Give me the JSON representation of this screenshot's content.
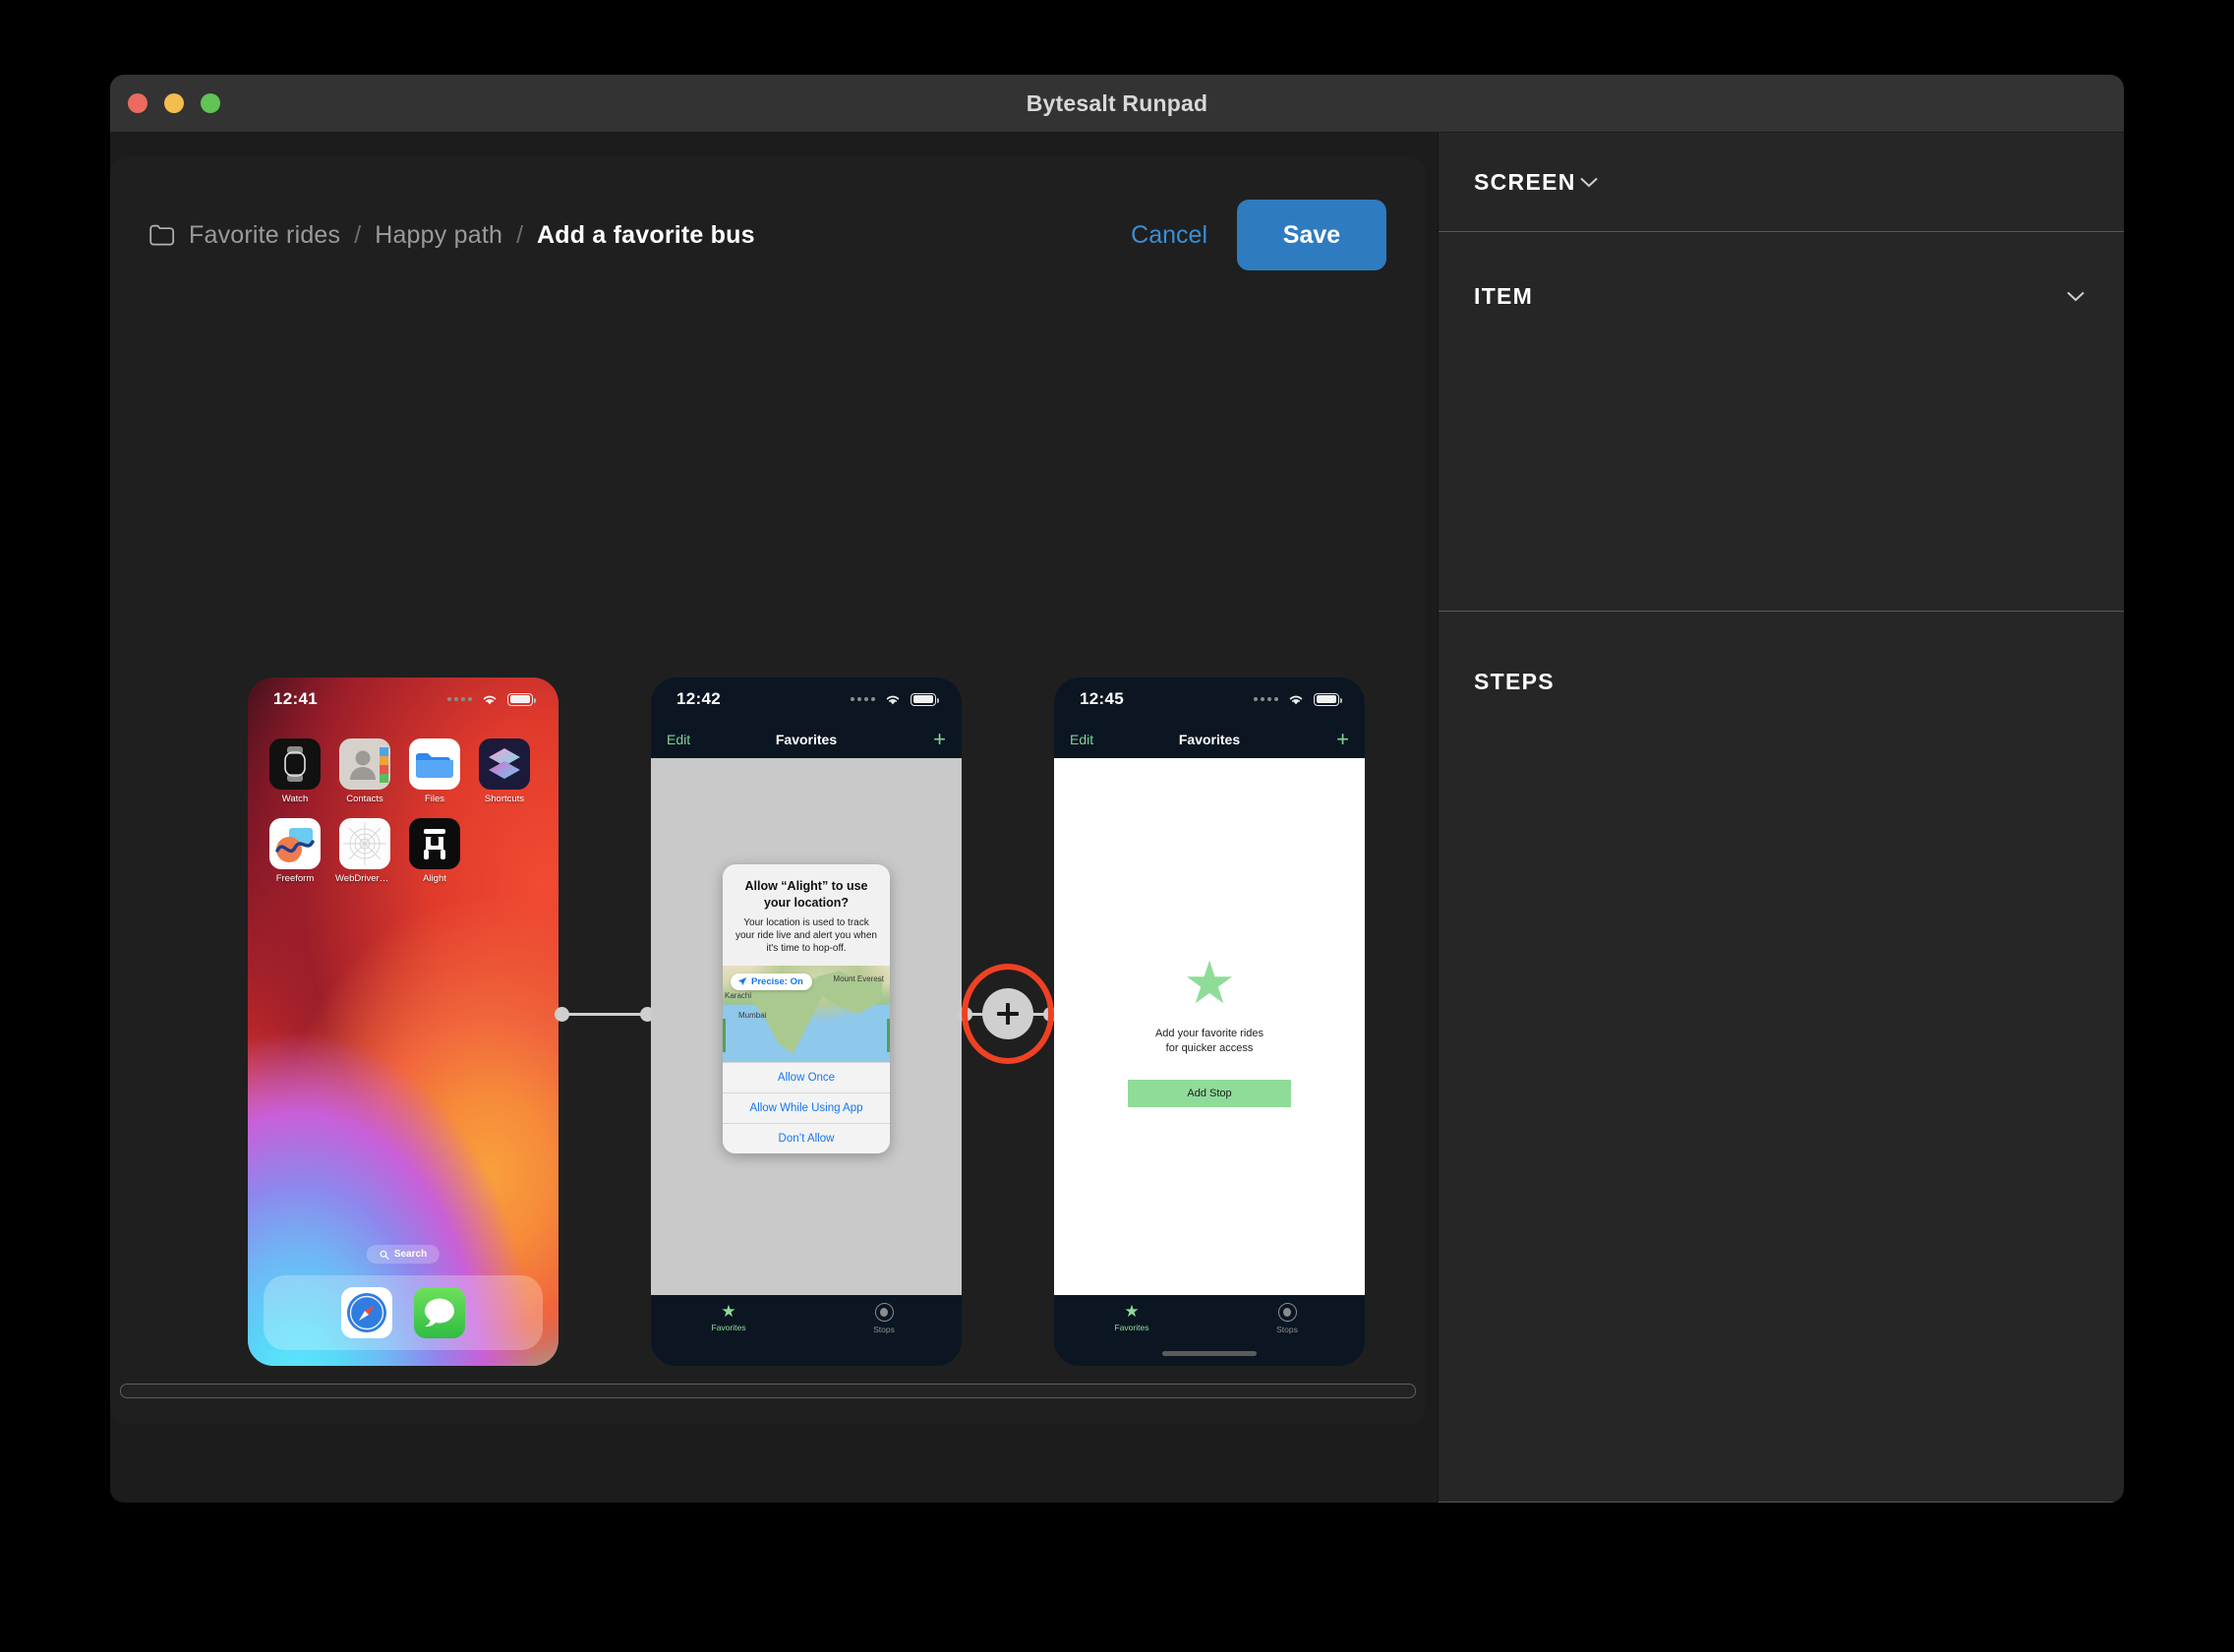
{
  "window": {
    "title": "Bytesalt Runpad",
    "traffic_lights": [
      "close-button",
      "minimize-button",
      "zoom-button"
    ]
  },
  "toolbar": {
    "breadcrumb": [
      {
        "label": "Favorite rides",
        "current": false
      },
      {
        "label": "Happy path",
        "current": false
      },
      {
        "label": "Add a favorite bus",
        "current": true
      }
    ],
    "separator": "/",
    "cancel_label": "Cancel",
    "save_label": "Save",
    "save_color": "#2e7cbf",
    "cancel_color": "#3a8fd6"
  },
  "inspector": {
    "sections": [
      {
        "title": "SCREEN",
        "collapsible": true
      },
      {
        "title": "ITEM",
        "collapsible": true
      },
      {
        "title": "STEPS",
        "collapsible": false
      }
    ]
  },
  "flow": {
    "screens": [
      {
        "kind": "ios-home",
        "status": {
          "time": "12:41",
          "wifi": "wifi-icon",
          "battery": "battery-icon"
        },
        "app_rows": [
          [
            {
              "label": "Watch",
              "icon": "watch-icon"
            },
            {
              "label": "Contacts",
              "icon": "contacts-icon"
            },
            {
              "label": "Files",
              "icon": "files-icon"
            },
            {
              "label": "Shortcuts",
              "icon": "shortcuts-icon"
            }
          ],
          [
            {
              "label": "Freeform",
              "icon": "freeform-icon"
            },
            {
              "label": "WebDriverAge...",
              "icon": "webdriveragent-icon"
            },
            {
              "label": "Alight",
              "icon": "alight-icon"
            }
          ]
        ],
        "search_label": "Search",
        "dock": [
          {
            "label": "Safari",
            "icon": "safari-icon"
          },
          {
            "label": "Messages",
            "icon": "messages-icon"
          }
        ]
      },
      {
        "kind": "ios-app-alert",
        "status": {
          "time": "12:42"
        },
        "nav": {
          "left": "Edit",
          "title": "Favorites",
          "right": "+"
        },
        "alert": {
          "title": "Allow “Alight” to use your location?",
          "message": "Your location is used to track your ride live and alert you when it's time to hop-off.",
          "precise_badge": "Precise: On",
          "map_labels": [
            "Mount Everest",
            "Karachi",
            "Mumbai"
          ],
          "buttons": [
            "Allow Once",
            "Allow While Using App",
            "Don’t Allow"
          ]
        },
        "tabs": [
          {
            "label": "Favorites",
            "icon": "star-icon",
            "active": true
          },
          {
            "label": "Stops",
            "icon": "stop-circle-icon",
            "active": false
          }
        ]
      },
      {
        "kind": "ios-app-empty",
        "status": {
          "time": "12:45"
        },
        "nav": {
          "left": "Edit",
          "title": "Favorites",
          "right": "+"
        },
        "empty": {
          "icon": "star-icon",
          "text": "Add your favorite rides\nfor quicker access",
          "button_label": "Add Stop",
          "button_color": "#8fdc99"
        },
        "tabs": [
          {
            "label": "Favorites",
            "icon": "star-icon",
            "active": true
          },
          {
            "label": "Stops",
            "icon": "stop-circle-icon",
            "active": false
          }
        ],
        "home_indicator": true
      }
    ],
    "connectors": [
      {
        "type": "line",
        "has_plus": false
      },
      {
        "type": "line",
        "has_plus": true,
        "highlight_color": "#ef4123"
      }
    ]
  }
}
